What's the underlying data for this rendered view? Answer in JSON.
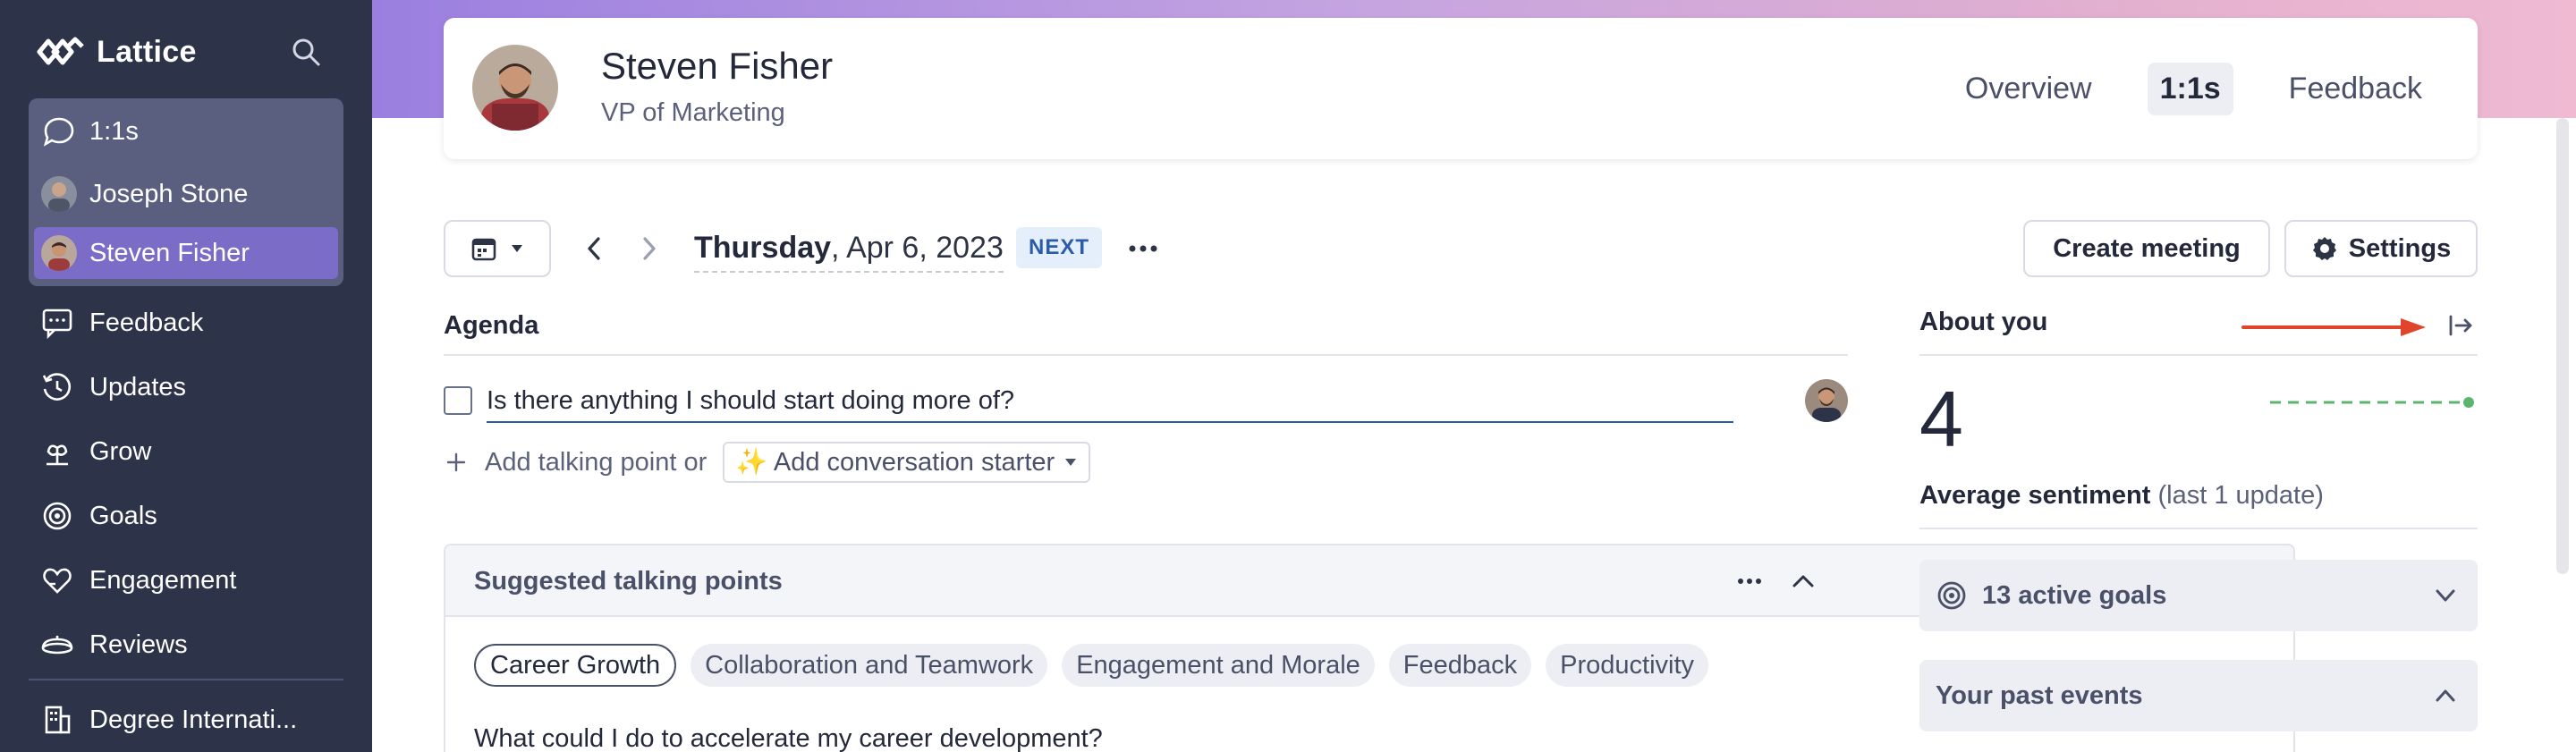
{
  "brand": {
    "name": "Lattice"
  },
  "sidebar": {
    "group": [
      {
        "label": "1:1s"
      },
      {
        "label": "Joseph Stone"
      },
      {
        "label": "Steven Fisher"
      }
    ],
    "items": [
      {
        "label": "Feedback",
        "icon": "feedback-icon"
      },
      {
        "label": "Updates",
        "icon": "updates-icon"
      },
      {
        "label": "Grow",
        "icon": "grow-icon"
      },
      {
        "label": "Goals",
        "icon": "goals-icon"
      },
      {
        "label": "Engagement",
        "icon": "engagement-icon"
      },
      {
        "label": "Reviews",
        "icon": "reviews-icon"
      }
    ],
    "org": {
      "label": "Degree Internati..."
    }
  },
  "header": {
    "name": "Steven Fisher",
    "title": "VP of Marketing",
    "tabs": [
      {
        "label": "Overview"
      },
      {
        "label": "1:1s"
      },
      {
        "label": "Feedback"
      }
    ]
  },
  "toolbar": {
    "day": "Thursday",
    "date": ", Apr 6, 2023",
    "badge": "NEXT",
    "create_label": "Create meeting",
    "settings_label": "Settings"
  },
  "agenda": {
    "title": "Agenda",
    "item": "Is there anything I should start doing more of?",
    "add_prefix": "Add talking point or",
    "starter_label": "✨ Add conversation starter"
  },
  "suggested": {
    "title": "Suggested talking points",
    "chips": [
      {
        "label": "Career Growth"
      },
      {
        "label": "Collaboration and Teamwork"
      },
      {
        "label": "Engagement and Morale"
      },
      {
        "label": "Feedback"
      },
      {
        "label": "Productivity"
      }
    ],
    "question": "What could I do to accelerate my career development?"
  },
  "about": {
    "title": "About you",
    "value": "4",
    "sentiment_label": "Average sentiment",
    "sentiment_note": "(last 1 update)",
    "goals_label": "13 active goals",
    "past_label": "Your past events"
  },
  "colors": {
    "sidebar_bg": "#2d3348",
    "accent": "#7b6cc8",
    "link_blue": "#2a5ca8",
    "sentiment_green": "#5cb46e",
    "annotation_red": "#e0452b"
  }
}
